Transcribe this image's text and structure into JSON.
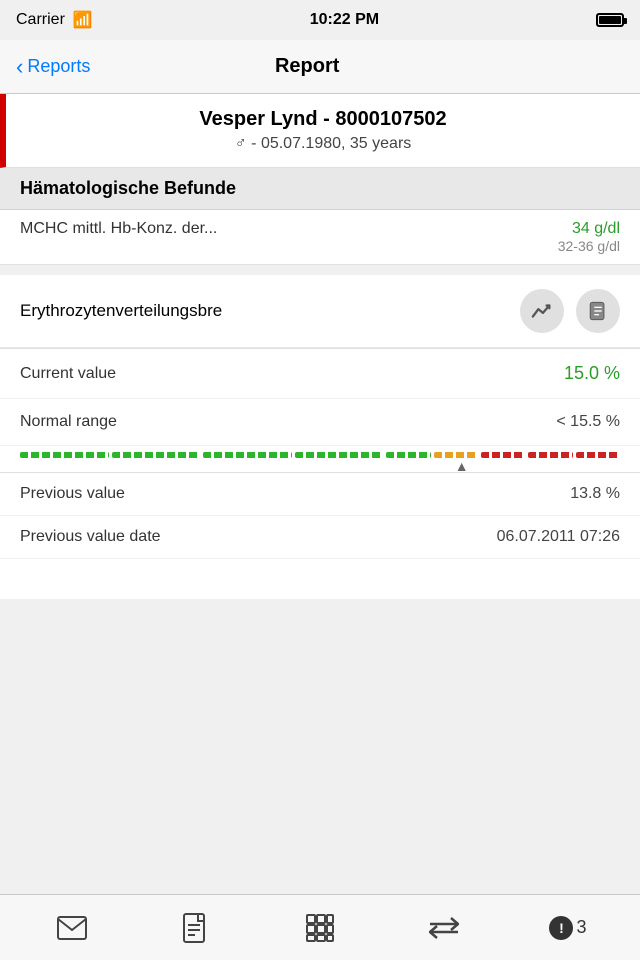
{
  "statusBar": {
    "carrier": "Carrier",
    "time": "10:22 PM"
  },
  "navBar": {
    "backLabel": "Reports",
    "title": "Report"
  },
  "patient": {
    "name": "Vesper Lynd - 8000107502",
    "info": "♂ - 05.07.1980, 35 years"
  },
  "section": {
    "title": "Hämatologische Befunde"
  },
  "mchcItem": {
    "label": "MCHC mittl. Hb-Konz. der...",
    "currentValue": "34 g/dl",
    "normalRange": "32-36 g/dl"
  },
  "detail": {
    "name": "Erythrozytenverteilungsbre",
    "currentLabel": "Current value",
    "currentValue": "15.0 %",
    "normalRangeLabel": "Normal range",
    "normalRangeValue": "< 15.5 %",
    "previousLabel": "Previous value",
    "previousValue": "13.8 %",
    "previousDateLabel": "Previous value date",
    "previousDateValue": "06.07.2011 07:26"
  },
  "toolbar": {
    "emailLabel": "email",
    "pdfLabel": "pdf",
    "gridLabel": "grid",
    "transferLabel": "transfer",
    "alertLabel": "alert",
    "alertCount": "3"
  },
  "rangeBar": {
    "segments": [
      {
        "color": "#2ab52a",
        "flex": 2
      },
      {
        "color": "#2ab52a",
        "flex": 2
      },
      {
        "color": "#2ab52a",
        "flex": 2
      },
      {
        "color": "#2ab52a",
        "flex": 2
      },
      {
        "color": "#2ab52a",
        "flex": 1
      },
      {
        "color": "#e8a020",
        "flex": 1
      },
      {
        "color": "#cc2222",
        "flex": 1
      },
      {
        "color": "#cc2222",
        "flex": 1
      },
      {
        "color": "#cc2222",
        "flex": 1
      }
    ],
    "indicatorPercent": 72
  }
}
